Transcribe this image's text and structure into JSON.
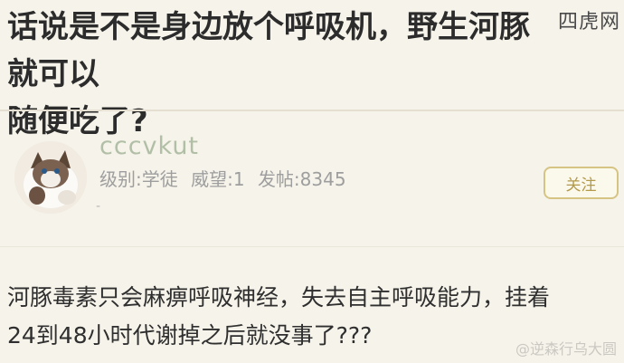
{
  "watermark_top": "四虎网",
  "post": {
    "title_line1": "话说是不是身边放个呼吸机，野生河豚就可以",
    "title_line2": "随便吃了?"
  },
  "reply": {
    "username": "cccvkut",
    "level": "级别:学徒",
    "prestige": "威望:1",
    "posts": "发帖:8345",
    "dash": "-",
    "follow_label": "关注",
    "content_line1": "河豚毒素只会麻痹呼吸神经，失去自主呼吸能力，挂着",
    "content_line2": "24到48小时代谢掉之后就没事了???"
  },
  "watermark_bottom": "@逆森行乌大圆",
  "colors": {
    "background": "#f6f3ea",
    "username": "#b1bfa6",
    "follow_border": "#d6c484",
    "follow_text": "#b39a4a"
  }
}
